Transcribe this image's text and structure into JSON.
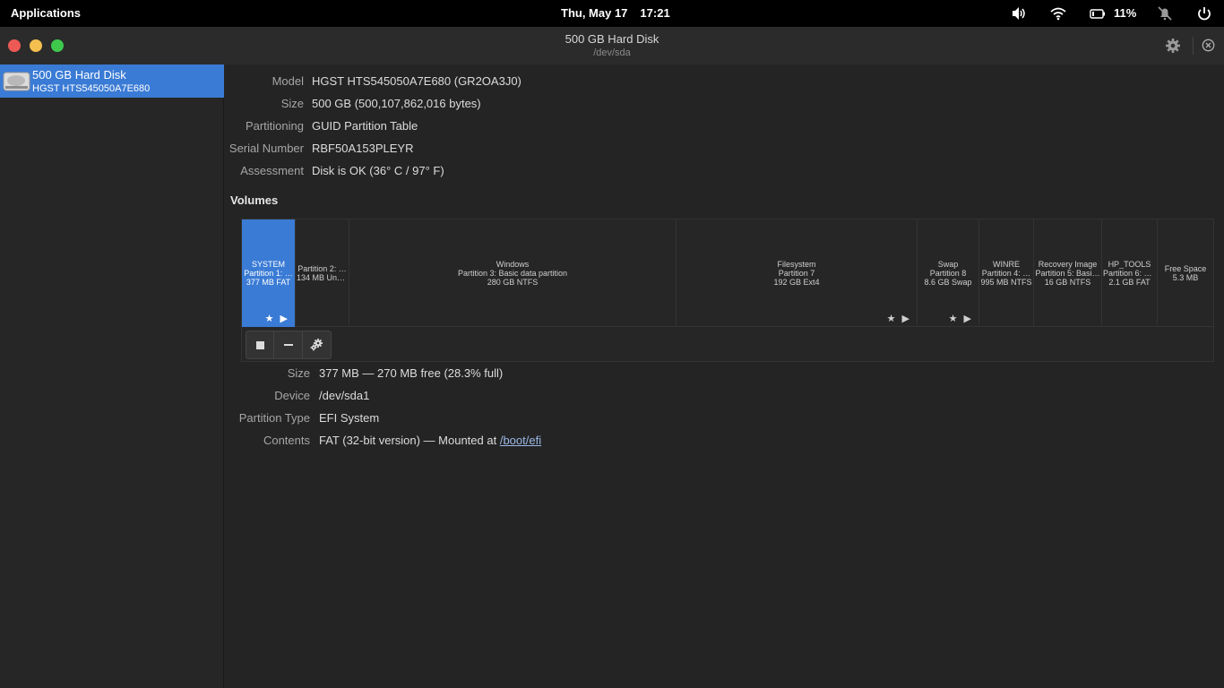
{
  "topbar": {
    "applications_label": "Applications",
    "date": "Thu, May 17",
    "time": "17:21",
    "battery_percent": "11%",
    "icons": [
      "volume-icon",
      "wifi-icon",
      "battery-icon",
      "notifications-off-icon",
      "power-icon"
    ]
  },
  "window": {
    "title": "500 GB Hard Disk",
    "subtitle": "/dev/sda",
    "controls": {
      "close_color": "#ed5a55",
      "minimize_color": "#f4bf4f",
      "maximize_color": "#3ec94d"
    }
  },
  "sidebar": {
    "items": [
      {
        "name": "500 GB Hard Disk",
        "sub": "HGST HTS545050A7E680",
        "selected": true
      }
    ]
  },
  "disk": {
    "model_label": "Model",
    "model_value": "HGST HTS545050A7E680 (GR2OA3J0)",
    "size_label": "Size",
    "size_value": "500 GB (500,107,862,016 bytes)",
    "partitioning_label": "Partitioning",
    "partitioning_value": "GUID Partition Table",
    "serial_label": "Serial Number",
    "serial_value": "RBF50A153PLEYR",
    "assessment_label": "Assessment",
    "assessment_value": "Disk is OK (36° C / 97° F)"
  },
  "volumes": {
    "heading": "Volumes",
    "partitions": [
      {
        "l1": "SYSTEM",
        "l2": "Partition 1: …",
        "l3": "377 MB FAT",
        "marks": "★ ▶",
        "selected": true
      },
      {
        "l1": "",
        "l2": "Partition 2: …",
        "l3": "134 MB Unk…",
        "marks": "",
        "selected": false
      },
      {
        "l1": "Windows",
        "l2": "Partition 3: Basic data partition",
        "l3": "280 GB NTFS",
        "marks": "",
        "selected": false
      },
      {
        "l1": "Filesystem",
        "l2": "Partition 7",
        "l3": "192 GB Ext4",
        "marks": "★ ▶",
        "selected": false
      },
      {
        "l1": "Swap",
        "l2": "Partition 8",
        "l3": "8.6 GB Swap",
        "marks": "★ ▶",
        "selected": false
      },
      {
        "l1": "WINRE",
        "l2": "Partition 4: …",
        "l3": "995 MB NTFS",
        "marks": "",
        "selected": false
      },
      {
        "l1": "Recovery Image",
        "l2": "Partition 5: Basi…",
        "l3": "16 GB NTFS",
        "marks": "",
        "selected": false
      },
      {
        "l1": "HP_TOOLS",
        "l2": "Partition 6: B…",
        "l3": "2.1 GB FAT",
        "marks": "",
        "selected": false
      },
      {
        "l1": "Free Space",
        "l2": "5.3 MB",
        "l3": "",
        "marks": "",
        "selected": false
      }
    ],
    "tools": [
      "stop-icon",
      "minus-icon",
      "gears-icon"
    ]
  },
  "partition_details": {
    "size_label": "Size",
    "size_value": "377 MB — 270 MB free (28.3% full)",
    "device_label": "Device",
    "device_value": "/dev/sda1",
    "type_label": "Partition Type",
    "type_value": "EFI System",
    "contents_label": "Contents",
    "contents_prefix": "FAT (32-bit version) — Mounted at ",
    "contents_link": "/boot/efi"
  },
  "colors": {
    "accent": "#3a7bd5",
    "background": "#242424"
  }
}
